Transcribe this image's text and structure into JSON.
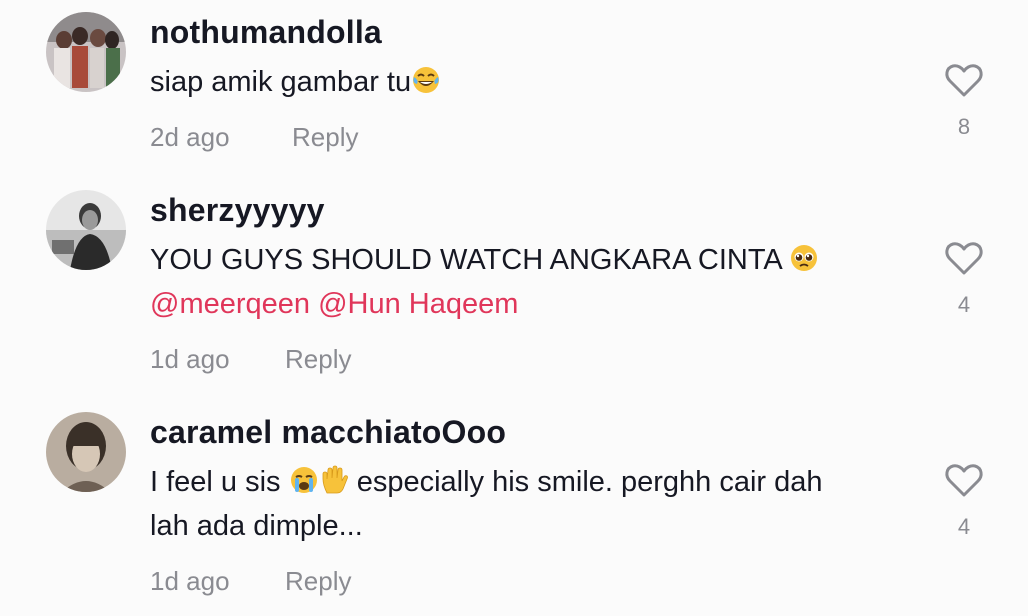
{
  "comments": [
    {
      "username": "nothumandolla",
      "text": "siap amik gambar tu",
      "emoji": "😂",
      "time": "2d ago",
      "reply_label": "Reply",
      "likes": "8"
    },
    {
      "username": "sherzyyyyy",
      "text": "YOU GUYS SHOULD WATCH ANGKARA CINTA",
      "emoji": "🥺",
      "mention1": "@meerqeen",
      "mention2": "@Hun Haqeem",
      "time": "1d ago",
      "reply_label": "Reply",
      "likes": "4"
    },
    {
      "username": "caramel macchiatoOoo",
      "text_prefix": "I feel u sis",
      "emoji1": "😭",
      "emoji2": "✋",
      "text_suffix": "especially his smile. perghh cair dah",
      "text_line2": "lah ada dimple...",
      "time": "1d ago",
      "reply_label": "Reply",
      "likes": "4"
    }
  ],
  "colors": {
    "mention": "#e0365a",
    "meta": "#8a8b91",
    "text": "#161823"
  },
  "icons": {
    "like": "heart-outline-icon"
  }
}
